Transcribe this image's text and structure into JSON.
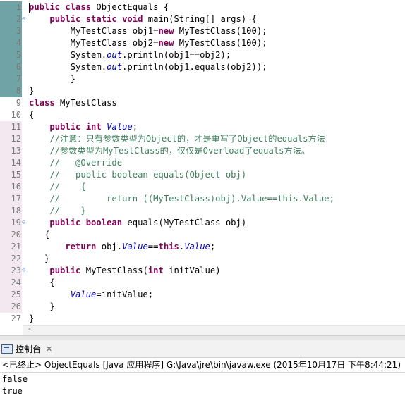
{
  "editor": {
    "lines": [
      {
        "num": "1",
        "gutter": "sel",
        "fold": "",
        "tokens": [
          [
            "kw",
            "public class "
          ],
          [
            "pl",
            "ObjectEquals {"
          ]
        ]
      },
      {
        "num": "2",
        "gutter": "sel",
        "fold": "⊖",
        "tokens": [
          [
            "pl",
            "    "
          ],
          [
            "kw",
            "public static void "
          ],
          [
            "pl",
            "main(String[] args) {"
          ]
        ]
      },
      {
        "num": "3",
        "gutter": "sel",
        "fold": "",
        "tokens": [
          [
            "pl",
            "        MyTestClass obj1="
          ],
          [
            "kw",
            "new "
          ],
          [
            "pl",
            "MyTestClass(100);"
          ]
        ]
      },
      {
        "num": "4",
        "gutter": "sel",
        "fold": "",
        "tokens": [
          [
            "pl",
            "        MyTestClass obj2="
          ],
          [
            "kw",
            "new "
          ],
          [
            "pl",
            "MyTestClass(100);"
          ]
        ]
      },
      {
        "num": "5",
        "gutter": "sel",
        "fold": "",
        "tokens": [
          [
            "pl",
            "        System."
          ],
          [
            "fld",
            "out"
          ],
          [
            "pl",
            ".println(obj1==obj2);"
          ]
        ]
      },
      {
        "num": "6",
        "gutter": "sel",
        "fold": "",
        "tokens": [
          [
            "pl",
            "        System."
          ],
          [
            "fld",
            "out"
          ],
          [
            "pl",
            ".println(obj1.equals(obj2));"
          ]
        ]
      },
      {
        "num": "7",
        "gutter": "sel",
        "fold": "",
        "tokens": [
          [
            "pl",
            "        }"
          ]
        ]
      },
      {
        "num": "8",
        "gutter": "sel",
        "fold": "",
        "tokens": [
          [
            "pl",
            "}"
          ]
        ]
      },
      {
        "num": "9",
        "gutter": "",
        "fold": "",
        "tokens": [
          [
            "kw",
            "class "
          ],
          [
            "pl",
            "MyTestClass"
          ]
        ]
      },
      {
        "num": "10",
        "gutter": "",
        "fold": "",
        "tokens": [
          [
            "pl",
            "{"
          ]
        ]
      },
      {
        "num": "11",
        "gutter": "mod",
        "fold": "",
        "tokens": [
          [
            "pl",
            "    "
          ],
          [
            "kw",
            "public int "
          ],
          [
            "fld",
            "Value"
          ],
          [
            "pl",
            ";"
          ]
        ]
      },
      {
        "num": "12",
        "gutter": "mod",
        "fold": "",
        "tokens": [
          [
            "cm",
            "    //注意：只有参数类型为Object的，才是重写了Object的equals方法"
          ]
        ]
      },
      {
        "num": "13",
        "gutter": "mod",
        "fold": "",
        "tokens": [
          [
            "cm",
            "    //参数类型为MyTestClass的，仅仅是Overload了equals方法。"
          ]
        ]
      },
      {
        "num": "14",
        "gutter": "mod",
        "fold": "",
        "tokens": [
          [
            "cm",
            "    //   @Override"
          ]
        ]
      },
      {
        "num": "15",
        "gutter": "mod",
        "fold": "",
        "tokens": [
          [
            "cm",
            "    //   public boolean equals(Object obj)"
          ]
        ]
      },
      {
        "num": "16",
        "gutter": "mod",
        "fold": "",
        "tokens": [
          [
            "cm",
            "    //    {"
          ]
        ]
      },
      {
        "num": "17",
        "gutter": "mod",
        "fold": "",
        "tokens": [
          [
            "cm",
            "    //         return ((MyTestClass)obj).Value==this.Value;"
          ]
        ]
      },
      {
        "num": "18",
        "gutter": "mod",
        "fold": "",
        "tokens": [
          [
            "cm",
            "    //    }"
          ]
        ]
      },
      {
        "num": "19",
        "gutter": "mod",
        "fold": "⊖",
        "tokens": [
          [
            "pl",
            "    "
          ],
          [
            "kw",
            "public boolean "
          ],
          [
            "pl",
            "equals(MyTestClass obj)"
          ]
        ]
      },
      {
        "num": "20",
        "gutter": "mod",
        "fold": "",
        "tokens": [
          [
            "pl",
            "   {"
          ]
        ]
      },
      {
        "num": "21",
        "gutter": "mod",
        "fold": "",
        "tokens": [
          [
            "pl",
            "       "
          ],
          [
            "kw",
            "return "
          ],
          [
            "pl",
            "obj."
          ],
          [
            "fld",
            "Value"
          ],
          [
            "pl",
            "=="
          ],
          [
            "kw",
            "this"
          ],
          [
            "pl",
            "."
          ],
          [
            "fld",
            "Value"
          ],
          [
            "pl",
            ";"
          ]
        ]
      },
      {
        "num": "22",
        "gutter": "mod",
        "fold": "",
        "tokens": [
          [
            "pl",
            "   }"
          ]
        ]
      },
      {
        "num": "23",
        "gutter": "mod",
        "fold": "⊖",
        "tokens": [
          [
            "pl",
            "    "
          ],
          [
            "kw",
            "public "
          ],
          [
            "pl",
            "MyTestClass("
          ],
          [
            "kw",
            "int "
          ],
          [
            "pl",
            "initValue)"
          ]
        ]
      },
      {
        "num": "24",
        "gutter": "mod",
        "fold": "",
        "tokens": [
          [
            "pl",
            "    {"
          ]
        ]
      },
      {
        "num": "25",
        "gutter": "mod",
        "fold": "",
        "tokens": [
          [
            "pl",
            "        "
          ],
          [
            "fld",
            "Value"
          ],
          [
            "pl",
            "=initValue;"
          ]
        ]
      },
      {
        "num": "26",
        "gutter": "mod",
        "fold": "",
        "tokens": [
          [
            "pl",
            "    }"
          ]
        ]
      },
      {
        "num": "27",
        "gutter": "",
        "fold": "",
        "tokens": [
          [
            "pl",
            "}"
          ]
        ]
      }
    ]
  },
  "console": {
    "tab_label": "控制台",
    "close_symbol": "✕",
    "status": "<已终止> ObjectEquals [Java 应用程序] G:\\Java\\jre\\bin\\javaw.exe (2015年10月17日 下午8:44:21)",
    "output": [
      "false",
      "true"
    ]
  },
  "colors": {
    "keyword": "#7f0055",
    "field": "#0000c0",
    "comment": "#3f7f5f",
    "plain": "#000000"
  }
}
